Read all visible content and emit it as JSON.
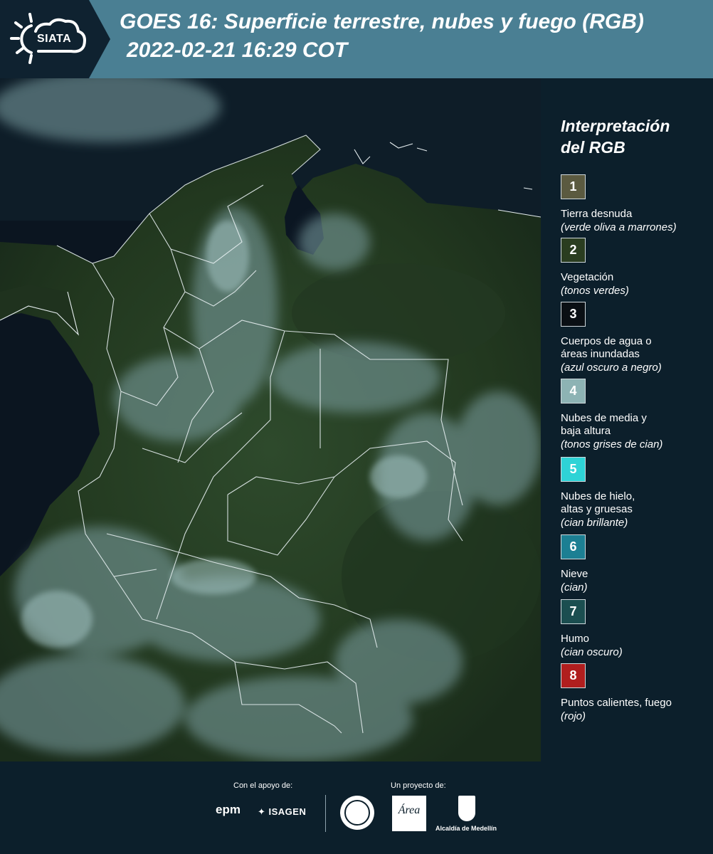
{
  "header": {
    "logo_text": "SIATA",
    "title_line1": "GOES 16: Superficie terrestre, nubes y fuego (RGB)",
    "title_line2": "2022-02-21 16:29 COT"
  },
  "legend": {
    "title_line1": "Interpretación",
    "title_line2": "del RGB",
    "items": [
      {
        "number": "1",
        "color": "#5b5a40",
        "label": "Tierra desnuda",
        "hint": "(verde oliva a marrones)"
      },
      {
        "number": "2",
        "color": "#2a3d20",
        "label": "Vegetación",
        "hint": "(tonos verdes)"
      },
      {
        "number": "3",
        "color": "#0a0f14",
        "label": "Cuerpos de agua o áreas inundadas",
        "hint": "(azul oscuro a negro)"
      },
      {
        "number": "4",
        "color": "#8db3b4",
        "label": "Nubes de media y baja altura",
        "hint": "(tonos grises de cian)"
      },
      {
        "number": "5",
        "color": "#2ed3d6",
        "label": "Nubes de hielo, altas y gruesas",
        "hint": "(cian brillante)"
      },
      {
        "number": "6",
        "color": "#1c7f93",
        "label": "Nieve",
        "hint": "(cian)"
      },
      {
        "number": "7",
        "color": "#1b4e50",
        "label": "Humo",
        "hint": "(cian oscuro)"
      },
      {
        "number": "8",
        "color": "#b01e1e",
        "label": "Puntos calientes, fuego",
        "hint": "(rojo)"
      }
    ]
  },
  "footer": {
    "support_label": "Con el apoyo de:",
    "project_label": "Un proyecto de:",
    "epm": "epm",
    "isagen": "ISAGEN",
    "area_logo": "Área",
    "alcaldia": "Alcaldía de Medellín"
  }
}
